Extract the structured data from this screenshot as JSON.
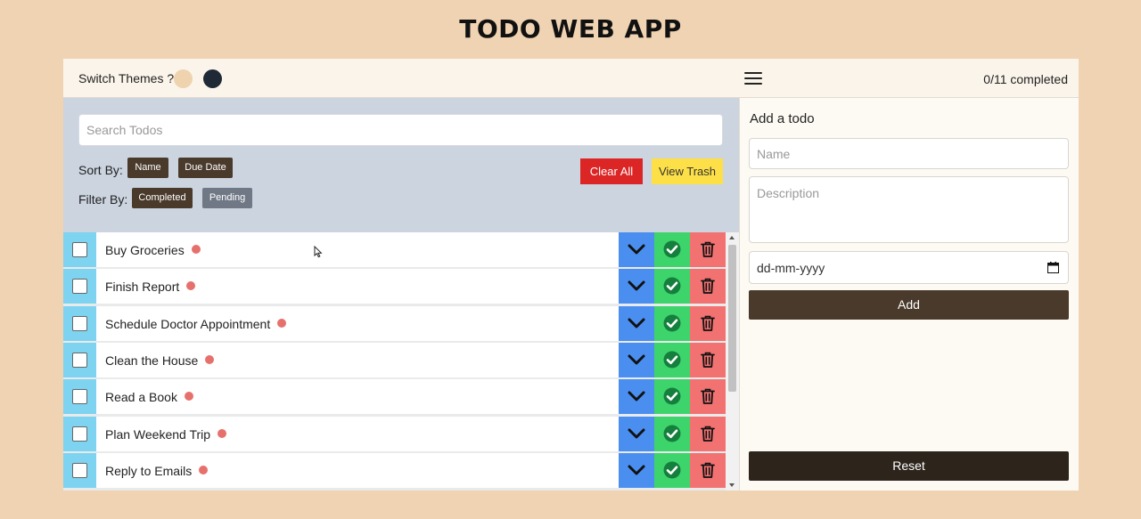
{
  "app": {
    "title": "TODO WEB APP"
  },
  "topbar": {
    "theme_label": "Switch Themes ?",
    "themes": [
      {
        "name": "light",
        "color": "#efd2ae"
      },
      {
        "name": "dark",
        "color": "#1f2a36"
      }
    ],
    "menu_icon": "hamburger-menu-icon",
    "completed_status": "0/11 completed"
  },
  "controls": {
    "search_placeholder": "Search Todos",
    "sort_label": "Sort By:",
    "sort_options": [
      "Name",
      "Due Date"
    ],
    "filter_label": "Filter By:",
    "filter_options": [
      "Completed",
      "Pending"
    ],
    "clear_all": "Clear All",
    "view_trash": "View Trash"
  },
  "todos": [
    {
      "name": "Buy Groceries",
      "completed": false
    },
    {
      "name": "Finish Report",
      "completed": false
    },
    {
      "name": "Schedule Doctor Appointment",
      "completed": false
    },
    {
      "name": "Clean the House",
      "completed": false
    },
    {
      "name": "Read a Book",
      "completed": false
    },
    {
      "name": "Plan Weekend Trip",
      "completed": false
    },
    {
      "name": "Reply to Emails",
      "completed": false
    }
  ],
  "row_actions": [
    "chevron-down-icon",
    "check-circle-icon",
    "trash-icon"
  ],
  "form": {
    "title": "Add a todo",
    "name_placeholder": "Name",
    "description_placeholder": "Description",
    "date_placeholder": "dd-mm-yyyy",
    "add_label": "Add",
    "reset_label": "Reset"
  },
  "colors": {
    "background": "#f0d3b2",
    "priority_dot": "#e6706c",
    "expand": "#4a8ff0",
    "done": "#3dd46c",
    "delete": "#f27272",
    "checkbox_cell": "#7dd3f0",
    "primary": "#4a3a2c",
    "clear_all": "#dc2626",
    "view_trash": "#fde047"
  }
}
